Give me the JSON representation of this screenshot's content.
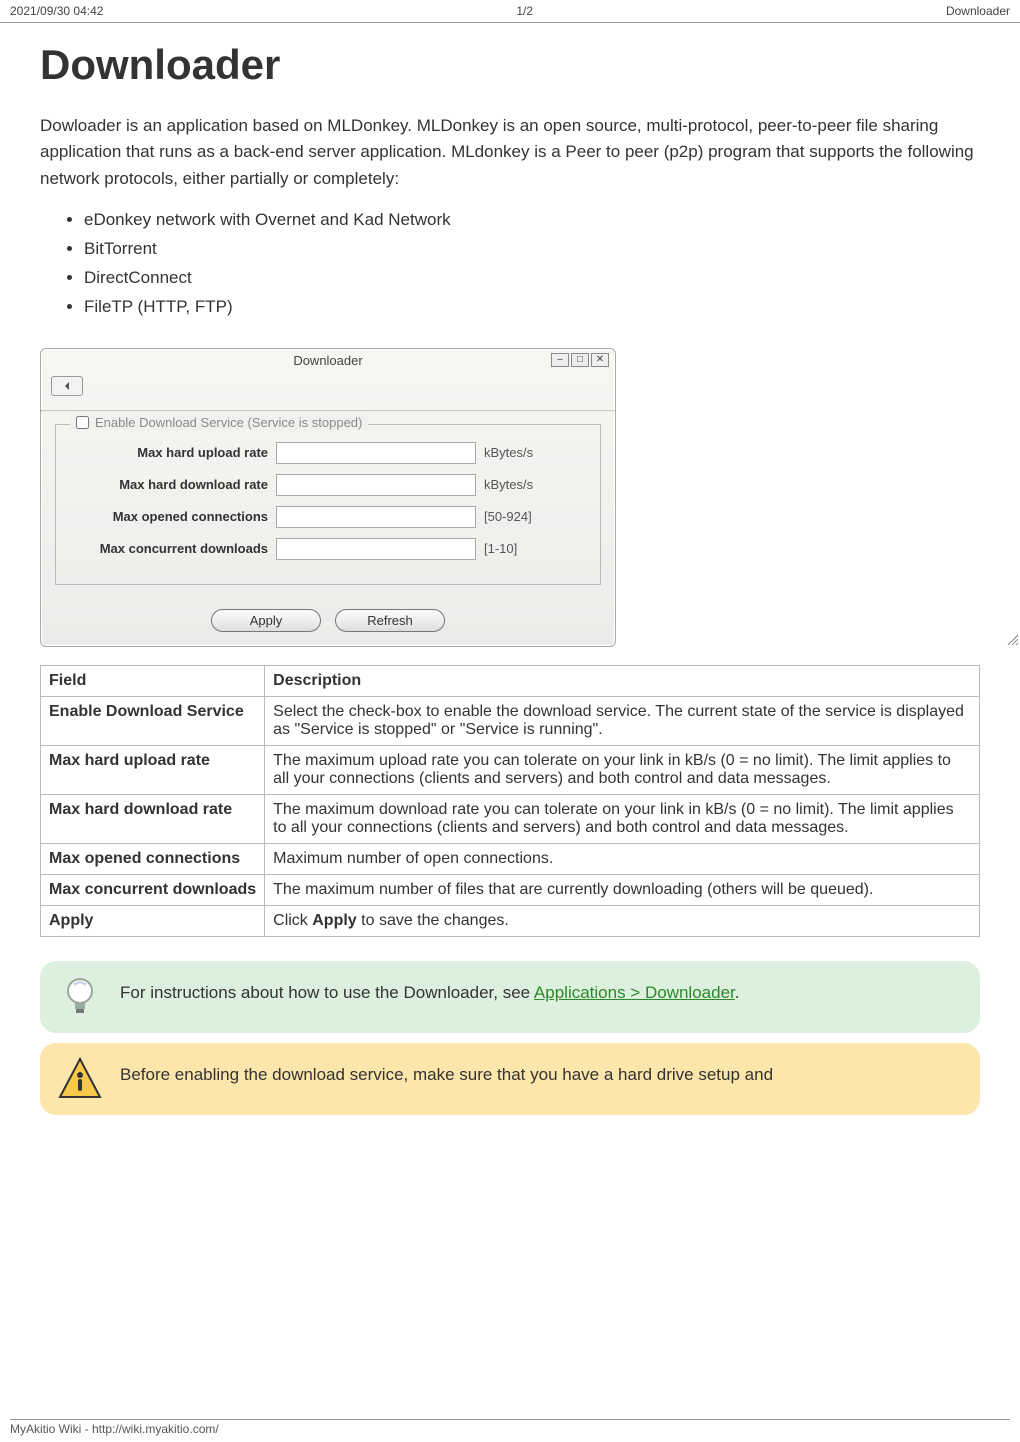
{
  "header": {
    "left": "2021/09/30 04:42",
    "center": "1/2",
    "right": "Downloader"
  },
  "title": "Downloader",
  "intro": "Dowloader is an application based on MLDonkey. MLDonkey is an open source, multi-protocol, peer-to-peer file sharing application that runs as a back-end server application. MLdonkey is a Peer to peer (p2p) program that supports the following network protocols, either partially or completely:",
  "bullets": [
    "eDonkey network with Overnet and Kad Network",
    "BitTorrent",
    "DirectConnect",
    "FileTP (HTTP, FTP)"
  ],
  "dialog": {
    "title": "Downloader",
    "legend": "Enable Download Service (Service is stopped)",
    "rows": [
      {
        "label": "Max hard upload rate",
        "suffix": "kBytes/s"
      },
      {
        "label": "Max hard download rate",
        "suffix": "kBytes/s"
      },
      {
        "label": "Max opened connections",
        "suffix": "[50-924]"
      },
      {
        "label": "Max concurrent downloads",
        "suffix": "[1-10]"
      }
    ],
    "buttons": {
      "apply": "Apply",
      "refresh": "Refresh"
    }
  },
  "table": {
    "header": {
      "field": "Field",
      "description": "Description"
    },
    "rows": [
      {
        "field": "Enable Download Service",
        "desc": "Select the check-box to enable the download service. The current state of the service is displayed as \"Service is stopped\" or \"Service is running\"."
      },
      {
        "field": "Max hard upload rate",
        "desc": "The maximum upload rate you can tolerate on your link in kB/s (0 = no limit). The limit applies to all your connections (clients and servers) and both control and data messages."
      },
      {
        "field": "Max hard download rate",
        "desc": "The maximum download rate you can tolerate on your link in kB/s (0 = no limit). The limit applies to all your connections (clients and servers) and both control and data messages."
      },
      {
        "field": "Max opened connections",
        "desc": "Maximum number of open connections."
      },
      {
        "field": "Max concurrent downloads",
        "desc": "The maximum number of files that are currently downloading (others will be queued)."
      },
      {
        "field": "Apply",
        "desc_prefix": "Click ",
        "desc_bold": "Apply",
        "desc_suffix": " to save the changes."
      }
    ]
  },
  "tip": {
    "text_before": "For instructions about how to use the Downloader, see ",
    "link_text": "Applications > Downloader",
    "text_after": "."
  },
  "warn": {
    "text": "Before enabling the download service, make sure that you have a hard drive setup and"
  },
  "footer": "MyAkitio Wiki - http://wiki.myakitio.com/"
}
